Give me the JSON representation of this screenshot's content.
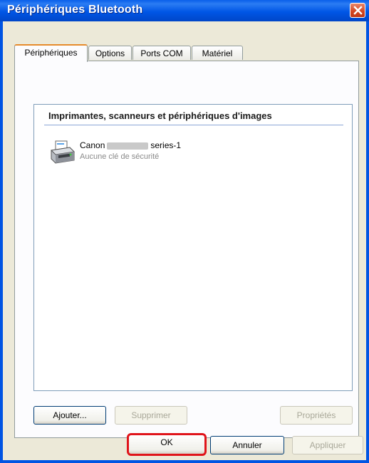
{
  "window": {
    "title": "Périphériques Bluetooth"
  },
  "tabs": [
    {
      "label": "Périphériques",
      "active": true
    },
    {
      "label": "Options",
      "active": false
    },
    {
      "label": "Ports COM",
      "active": false
    },
    {
      "label": "Matériel",
      "active": false
    }
  ],
  "device_list": {
    "group_header": "Imprimantes, scanneurs et périphériques d'images",
    "items": [
      {
        "name_prefix": "Canon",
        "name_suffix": "series-1",
        "status": "Aucune clé de sécurité",
        "icon": "printer-icon"
      }
    ]
  },
  "panel_buttons": {
    "add": "Ajouter...",
    "remove": "Supprimer",
    "properties": "Propriétés"
  },
  "dialog_buttons": {
    "ok": "OK",
    "cancel": "Annuler",
    "apply": "Appliquer"
  },
  "colors": {
    "titlebar": "#0054e3",
    "dialog_bg": "#ece9d8",
    "highlight": "#e0141a",
    "active_tab_accent": "#e68b2c"
  }
}
